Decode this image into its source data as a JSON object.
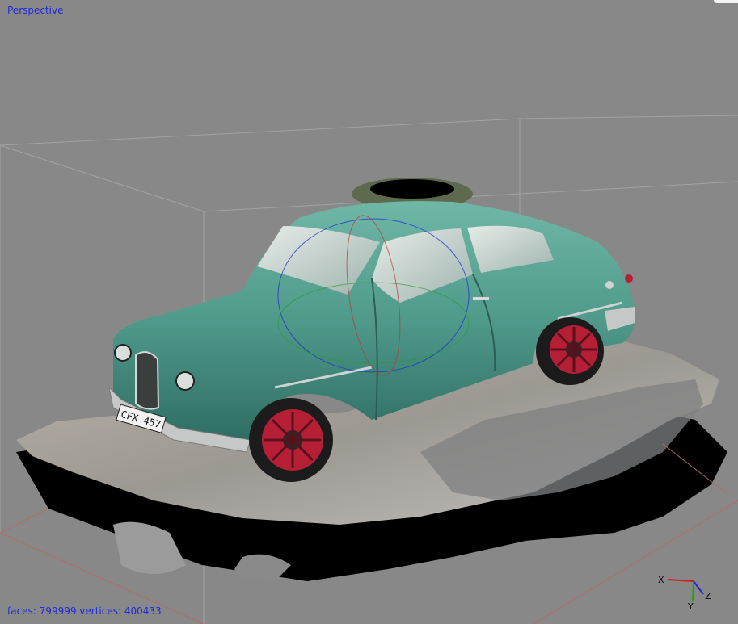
{
  "viewport": {
    "view_name": "Perspective",
    "background_color": "#888888",
    "overlay_text_color": "#1f2bd8"
  },
  "stats": {
    "faces_label": "faces:",
    "faces_value": "799999",
    "vertices_label": "vertices:",
    "vertices_value": "400433"
  },
  "axes": {
    "x_label": "X",
    "y_label": "Y",
    "z_label": "Z",
    "x_color": "#d11a1a",
    "y_color": "#1aa31a",
    "z_color": "#1a2fd1"
  },
  "model": {
    "body_color": "#4f9a8a",
    "wheel_color": "#b51f35",
    "plate_text": "CFX 457"
  }
}
